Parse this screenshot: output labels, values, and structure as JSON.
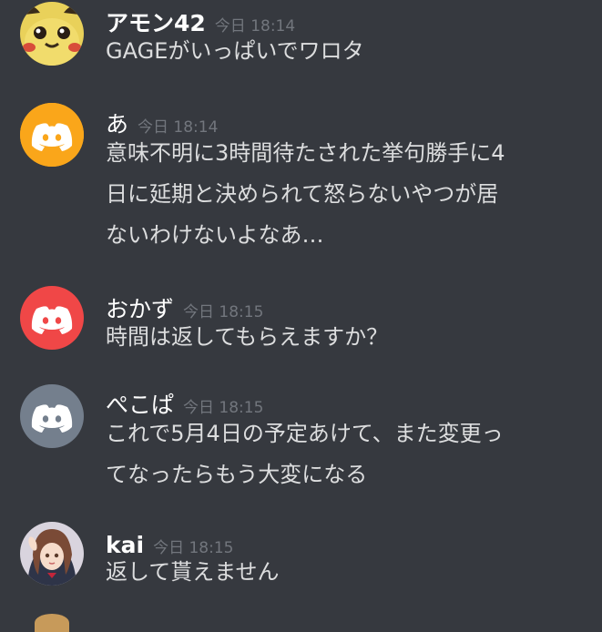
{
  "messages": [
    {
      "username": "アモン42",
      "timestamp": "今日 18:14",
      "lines": [
        "GAGEがいっぱいでワロタ"
      ],
      "avatar": "pikachu-avatar"
    },
    {
      "username": "あ",
      "timestamp": "今日 18:14",
      "lines": [
        "意味不明に3時間待たされた挙句勝手に4",
        "日に延期と決められて怒らないやつが居",
        "ないわけないよなあ…"
      ],
      "avatar": "discord-default-avatar",
      "avatar_color": "#faa61a"
    },
    {
      "username": "おかず",
      "timestamp": "今日 18:15",
      "lines": [
        "時間は返してもらえますか？"
      ],
      "avatar": "discord-default-avatar",
      "avatar_color": "#f04747"
    },
    {
      "username": "ぺこぱ",
      "timestamp": "今日 18:15",
      "lines": [
        "これで5月4日の予定あけて、また変更っ",
        "てなったらもう大変になる"
      ],
      "avatar": "discord-default-avatar",
      "avatar_color": "#747f8d"
    },
    {
      "username": "kai",
      "timestamp": "今日 18:15",
      "lines": [
        "返して貰えません"
      ],
      "avatar": "anime-girl-avatar"
    }
  ],
  "colors": {
    "background": "#36393f",
    "username": "#ffffff",
    "timestamp": "#72767d",
    "text": "#dcddde"
  }
}
